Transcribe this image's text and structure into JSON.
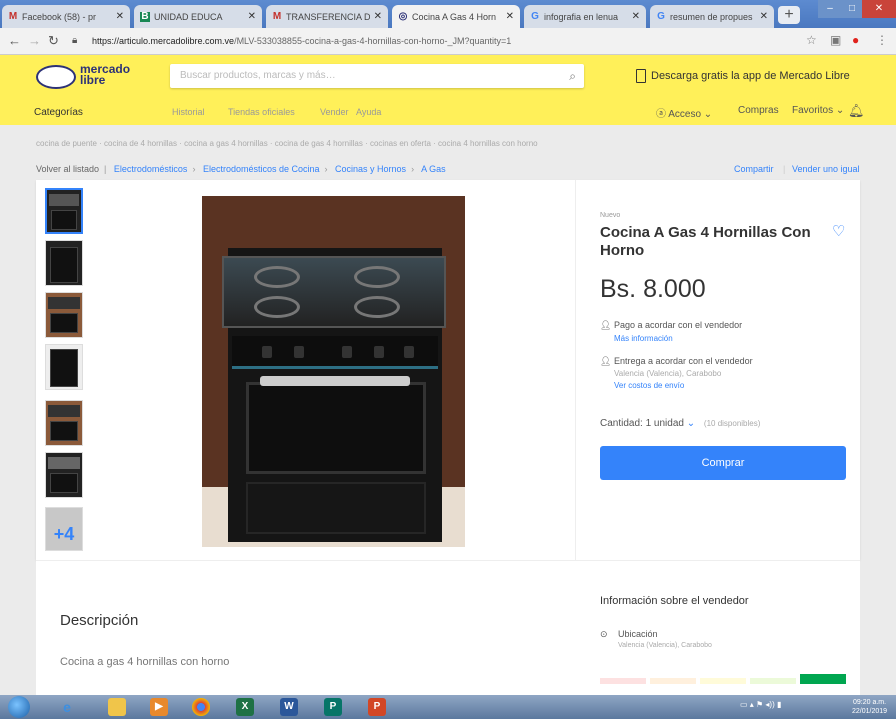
{
  "browser": {
    "tabs": [
      {
        "title": "Facebook (58) - pr",
        "icon": "M",
        "icon_color": "#c4302b"
      },
      {
        "title": "UNIDAD EDUCA",
        "icon": "B",
        "icon_color": "#198754"
      },
      {
        "title": "TRANSFERENCIA DE",
        "icon": "M",
        "icon_color": "#c4302b"
      },
      {
        "title": "Cocina A Gas 4 Horn",
        "icon": "◎",
        "icon_color": "#2d3277"
      },
      {
        "title": "infografia en lenua",
        "icon": "G",
        "icon_color": "#4285f4"
      },
      {
        "title": "resumen de propues",
        "icon": "G",
        "icon_color": "#4285f4"
      }
    ],
    "url_host": "https://articulo.mercadolibre.com.ve",
    "url_path": "/MLV-533038855-cocina-a-gas-4-hornillas-con-horno-_JM?quantity=1"
  },
  "header": {
    "logo_line1": "mercado",
    "logo_line2": "libre",
    "search_placeholder": "Buscar productos, marcas y más…",
    "promo": "Descarga gratis la app de Mercado Libre",
    "categories": "Categorías",
    "menu": [
      "Historial",
      "Tiendas oficiales",
      "Vender",
      "Ayuda"
    ],
    "user": [
      "Acceso ⌄",
      "Compras",
      "Favoritos ⌄"
    ]
  },
  "related": "cocina de puente · cocina de 4 hornillas · cocina a gas 4 hornillas · cocina de gas 4 hornillas · cocinas en oferta · cocina 4 hornillas con horno",
  "breadcrumb": {
    "back": "Volver al listado",
    "items": [
      "Electrodomésticos",
      "Electrodomésticos de Cocina",
      "Cocinas y Hornos",
      "A Gas"
    ],
    "share": "Compartir",
    "sell": "Vender uno igual"
  },
  "product": {
    "condition": "Nuevo",
    "title": "Cocina A Gas 4 Hornillas Con Horno",
    "price": "Bs. 8.000",
    "payment": "Pago a acordar con el vendedor",
    "payment_link": "Más información",
    "delivery": "Entrega a acordar con el vendedor",
    "delivery_place": "Valencia (Valencia), Carabobo",
    "delivery_link": "Ver costos de envío",
    "quantity": "Cantidad: 1 unidad",
    "available": "(10 disponibles)",
    "buy": "Comprar",
    "more_photos": "+4"
  },
  "description": {
    "title": "Descripción",
    "text": "Cocina a gas 4 hornillas con horno"
  },
  "seller": {
    "title": "Información sobre el vendedor",
    "location_label": "Ubicación",
    "location": "Valencia (Valencia), Carabobo"
  },
  "taskbar": {
    "clock_time": "09:20 a.m.",
    "clock_date": "22/01/2019"
  },
  "colors": {
    "brand_yellow": "#fff059",
    "accent_blue": "#3483fa",
    "reputation": [
      "#fde1e1",
      "#fff0dd",
      "#fffbd9",
      "#ecfad9",
      "#00a650"
    ]
  }
}
